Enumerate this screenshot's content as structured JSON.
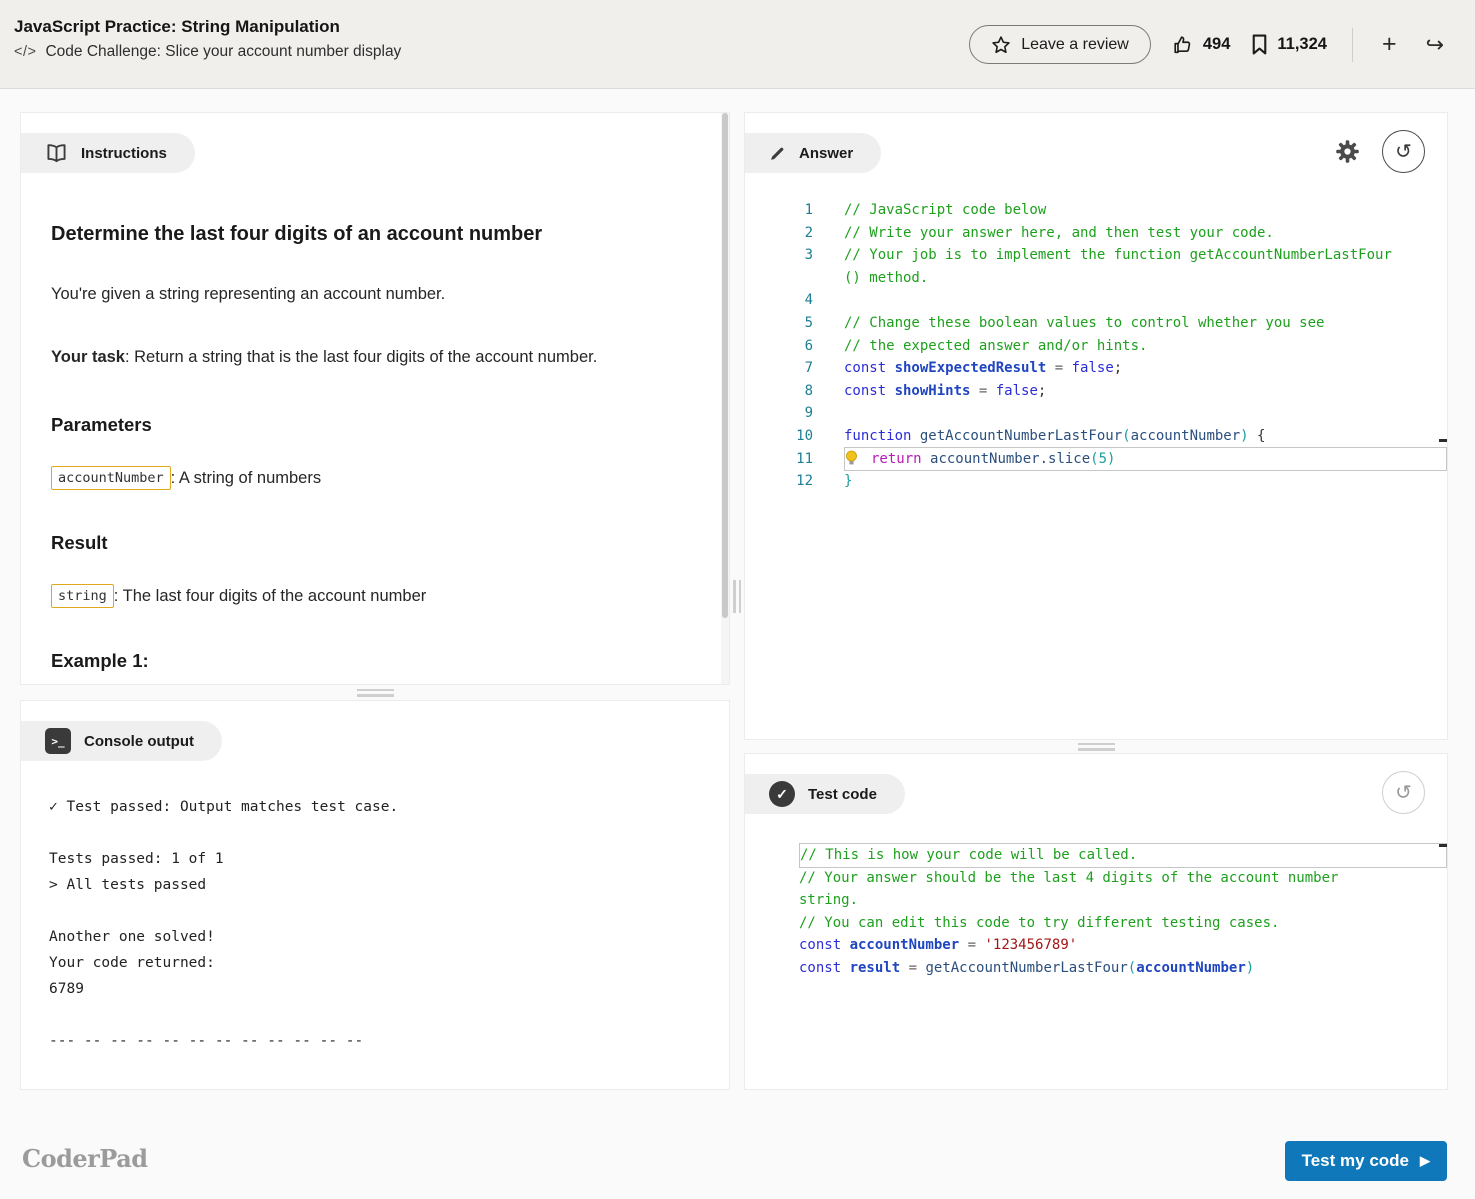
{
  "header": {
    "title": "JavaScript Practice: String Manipulation",
    "subtitle": "Code Challenge: Slice your account number display",
    "review_button": "Leave a review",
    "likes": "494",
    "bookmarks": "11,324"
  },
  "icons": {
    "code_tag": "</>",
    "plus": "+",
    "share": "↪",
    "reset": "↺",
    "terminal": ">_",
    "check": "✓",
    "play": "▶"
  },
  "instructions": {
    "tab": "Instructions",
    "heading": "Determine the last four digits of an account number",
    "intro": "You're given a string representing an account number.",
    "task_label": "Your task",
    "task_rest": ": Return a string that is the last four digits of the account number.",
    "parameters_heading": "Parameters",
    "param_name": "accountNumber",
    "param_desc": ": A string of numbers",
    "result_heading": "Result",
    "result_type": "string",
    "result_desc": ": The last four digits of the account number",
    "example_heading": "Example 1:"
  },
  "console": {
    "tab": "Console output",
    "lines": [
      "✓ Test passed: Output matches test case.",
      "",
      "Tests passed: 1 of 1",
      "> All tests passed",
      "",
      "Another one solved!",
      "Your code returned:",
      "6789",
      "",
      "--- -- -- -- -- -- -- -- -- -- -- --"
    ]
  },
  "answer": {
    "tab": "Answer",
    "lines": [
      {
        "n": "1",
        "t": [
          [
            "// JavaScript code below",
            "com"
          ]
        ]
      },
      {
        "n": "2",
        "t": [
          [
            "// Write your answer here, and then test your code.",
            "com"
          ]
        ]
      },
      {
        "n": "3",
        "t": [
          [
            "// Your job is to implement the function getAccountNumberLastFour",
            "com"
          ]
        ],
        "w": [
          [
            "() method.",
            "com"
          ]
        ]
      },
      {
        "n": "4",
        "t": []
      },
      {
        "n": "5",
        "t": [
          [
            "// Change these boolean values to control whether you see",
            "com"
          ]
        ]
      },
      {
        "n": "6",
        "t": [
          [
            "// the expected answer and/or hints.",
            "com"
          ]
        ]
      },
      {
        "n": "7",
        "t": [
          [
            "const ",
            "kw"
          ],
          [
            "showExpectedResult",
            "def"
          ],
          [
            " ",
            "pl"
          ],
          [
            "=",
            "op"
          ],
          [
            " ",
            "pl"
          ],
          [
            "false",
            "kw"
          ],
          [
            ";",
            "pl"
          ]
        ]
      },
      {
        "n": "8",
        "t": [
          [
            "const ",
            "kw"
          ],
          [
            "showHints",
            "def"
          ],
          [
            " ",
            "pl"
          ],
          [
            "=",
            "op"
          ],
          [
            " ",
            "pl"
          ],
          [
            "false",
            "kw"
          ],
          [
            ";",
            "pl"
          ]
        ]
      },
      {
        "n": "9",
        "t": []
      },
      {
        "n": "10",
        "t": [
          [
            "function ",
            "kw"
          ],
          [
            "getAccountNumberLastFour",
            "fn"
          ],
          [
            "(",
            "br"
          ],
          [
            "accountNumber",
            "fn"
          ],
          [
            ")",
            "br"
          ],
          [
            " {",
            "pl"
          ]
        ]
      },
      {
        "n": "11",
        "bulb": true,
        "active": true,
        "t": [
          [
            "return ",
            "ret"
          ],
          [
            "accountNumber.slice",
            "fn"
          ],
          [
            "(",
            "br"
          ],
          [
            "5",
            "num"
          ],
          [
            ")",
            "br"
          ]
        ]
      },
      {
        "n": "12",
        "t": [
          [
            "}",
            "br"
          ]
        ]
      }
    ]
  },
  "test_code": {
    "tab": "Test code",
    "lines": [
      {
        "active": true,
        "t": [
          [
            "// This is how your code will be called.",
            "com"
          ]
        ]
      },
      {
        "t": [
          [
            "// Your answer should be the last 4 digits of the account number",
            "com"
          ]
        ],
        "w": [
          [
            "string.",
            "com"
          ]
        ]
      },
      {
        "t": [
          [
            "// You can edit this code to try different testing cases.",
            "com"
          ]
        ]
      },
      {
        "t": [
          [
            "const ",
            "kw"
          ],
          [
            "accountNumber",
            "def"
          ],
          [
            " ",
            "pl"
          ],
          [
            "=",
            "op"
          ],
          [
            " ",
            "pl"
          ],
          [
            "'123456789'",
            "str"
          ]
        ]
      },
      {
        "t": [
          [
            "const ",
            "kw"
          ],
          [
            "result",
            "def"
          ],
          [
            " ",
            "pl"
          ],
          [
            "=",
            "op"
          ],
          [
            " ",
            "pl"
          ],
          [
            "getAccountNumberLastFour",
            "fn"
          ],
          [
            "(",
            "br"
          ],
          [
            "accountNumber",
            "def"
          ],
          [
            ")",
            "br"
          ]
        ]
      }
    ]
  },
  "footer": {
    "logo": "CoderPad",
    "test_button": "Test my code",
    "accent_color": "#0e78ba"
  }
}
